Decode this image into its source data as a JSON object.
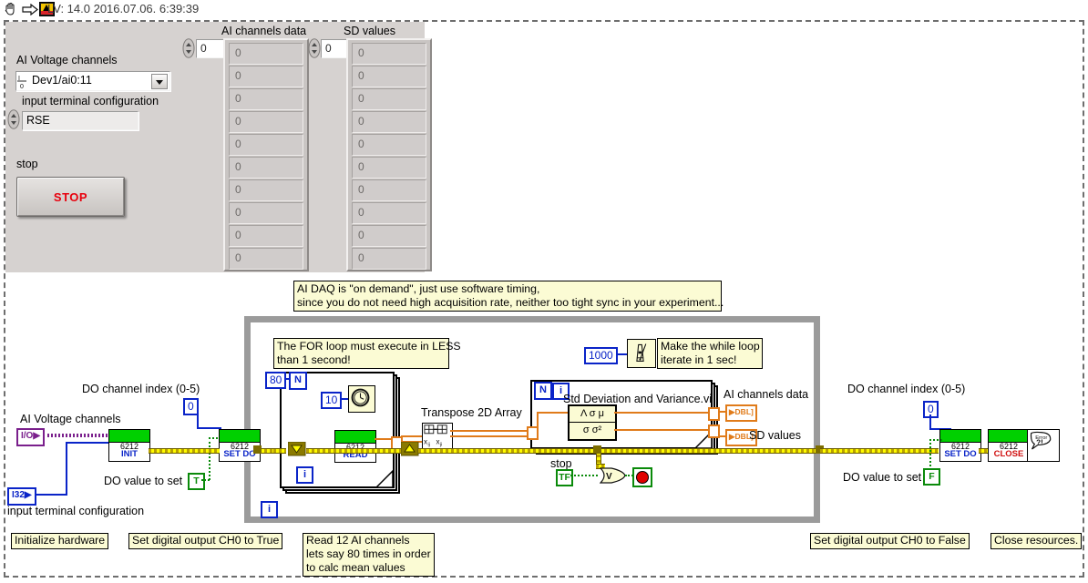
{
  "window": {
    "title": "LV: 14.0 2016.07.06. 6:39:39",
    "hand_icon": "hand-cursor-icon",
    "arrow_icon": "run-arrow-icon",
    "vi_icon": "labview-vi-icon"
  },
  "front_panel": {
    "ai_channels_label": "AI Voltage channels",
    "ai_channels_value": "Dev1/ai0:11",
    "itc_label": "input terminal configuration",
    "itc_value": "RSE",
    "stop_label": "stop",
    "stop_button": "STOP",
    "arrays": [
      {
        "title": "AI channels data",
        "index": "0",
        "cells": [
          "0",
          "0",
          "0",
          "0",
          "0",
          "0",
          "0",
          "0",
          "0",
          "0"
        ]
      },
      {
        "title": "SD values",
        "index": "0",
        "cells": [
          "0",
          "0",
          "0",
          "0",
          "0",
          "0",
          "0",
          "0",
          "0",
          "0"
        ]
      }
    ]
  },
  "diagram": {
    "comments": {
      "daq_note": "AI DAQ is \"on demand\", just use software timing,\nsince you do not need high acquisition rate, neither too tight sync in your experiment...",
      "for_loop_note": "The FOR loop must execute in LESS\nthan 1 second!",
      "while_wait_note": "Make the while loop\niterate in 1 sec!"
    },
    "left": {
      "do_channel_label": "DO channel index (0-5)",
      "do_channel_value": "0",
      "ai_channels_label": "AI Voltage channels",
      "ai_channels_terminal": "I/O",
      "itc_terminal": "I32",
      "itc_label": "input terminal configuration",
      "do_value_label": "DO value to set",
      "do_value_terminal": "T",
      "init_vi": {
        "model": "6212",
        "fn": "INIT"
      },
      "setdo_vi": {
        "model": "6212",
        "fn": "SET DO"
      }
    },
    "right": {
      "do_channel_label": "DO channel index (0-5)",
      "do_channel_value": "0",
      "do_value_label": "DO value to set",
      "do_value_terminal": "F",
      "setdo_vi": {
        "model": "6212",
        "fn": "SET DO"
      },
      "close_vi": {
        "model": "6212",
        "fn": "CLOSE"
      },
      "error_handler": "Error\n?!"
    },
    "for_loop": {
      "count_value": "80",
      "count_terminal": "N",
      "iter_terminal": "i",
      "wait_value": "10",
      "wait_icon": "wait-ms-clock-icon",
      "read_vi": {
        "model": "6212",
        "fn": "READ"
      }
    },
    "while_loop": {
      "wait_value": "1000",
      "wait_icon": "metronome-icon",
      "iter_terminal": "i",
      "stop_label": "stop",
      "stop_terminal": "TF",
      "or_gate": "V",
      "stop_loop_icon": "stop-sign-icon"
    },
    "transpose": {
      "label": "Transpose 2D Array",
      "icon": "transpose-2d-array-icon"
    },
    "stddev": {
      "title": "Std Deviation and Variance.vi",
      "row1": "Λ σ μ",
      "row2": "σ σ²",
      "n_terminal": "N",
      "i_terminal": "i",
      "out1_label": "AI channels data",
      "out1_type": "DBL",
      "out2_label": "SD values",
      "out2_type": "DBL"
    },
    "bottom_labels": {
      "init": "Initialize hardware",
      "set_true": "Set digital output CH0 to True",
      "read": "Read 12 AI channels\nlets say 80 times in order\nto calc mean values",
      "set_false": "Set digital output CH0 to False",
      "close": "Close resources."
    }
  },
  "colors": {
    "panel_grey": "#d6d2d0",
    "comment_yellow": "#fbfbd4",
    "daq_green": "#00d000",
    "wire_blue": "#0a24c8",
    "wire_orange": "#e07b1a",
    "error_wire": "#fffb00",
    "stop_red": "#e8000d"
  }
}
